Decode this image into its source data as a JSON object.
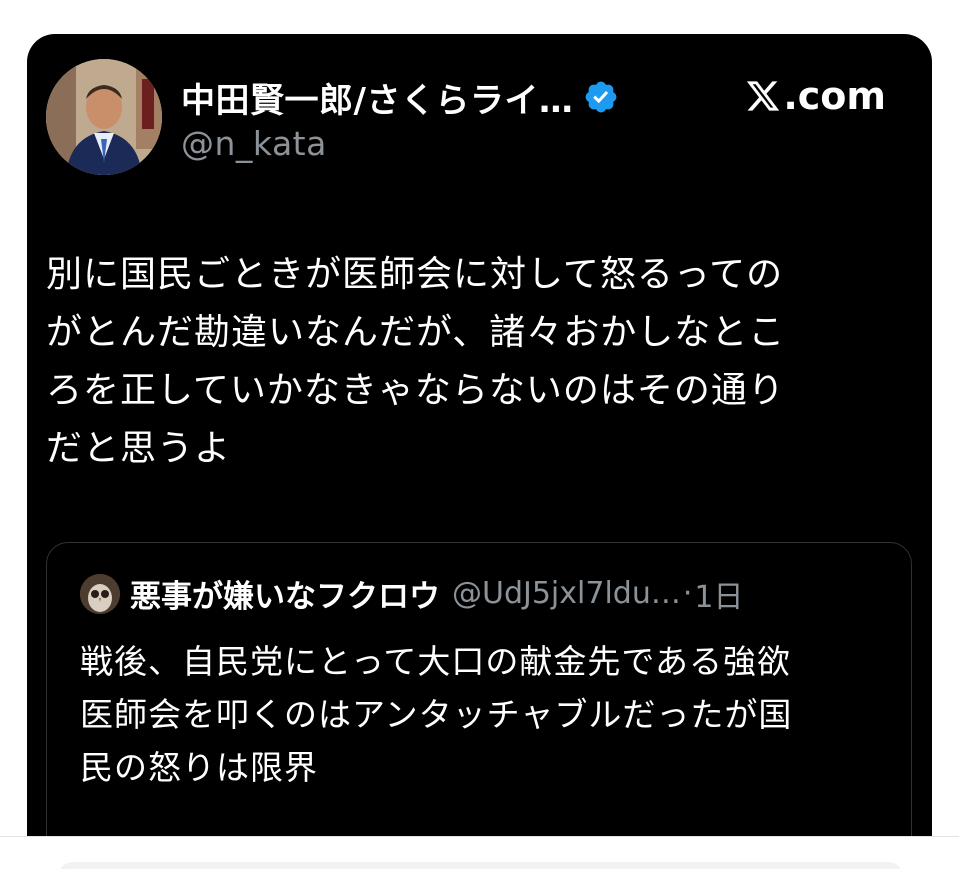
{
  "author": {
    "display_name": "中田賢一郎/さくらライ…",
    "handle": "@n_kata",
    "verified": true
  },
  "brand": {
    "label": ".com"
  },
  "tweet": {
    "lines": [
      "別に国民ごときが医師会に対して怒るっての",
      "がとんだ勘違いなんだが、諸々おかしなとこ",
      "ろを正していかなきゃならないのはその通り",
      "だと思うよ"
    ]
  },
  "quote": {
    "display_name": "悪事が嫌いなフクロウ",
    "handle": "@UdJ5jxl7ldu…",
    "separator": "·",
    "time": "1日",
    "lines": [
      "戦後、自民党にとって大口の献金先である強欲",
      "医師会を叩くのはアンタッチャブルだったが国",
      "民の怒りは限界"
    ]
  },
  "colors": {
    "background": "#000000",
    "text": "#ffffff",
    "muted": "#8b9298",
    "verified": "#1d9bf0",
    "border": "#2f3336"
  },
  "icons": {
    "verified": "verified-badge-icon",
    "brand": "x-logo-icon"
  }
}
